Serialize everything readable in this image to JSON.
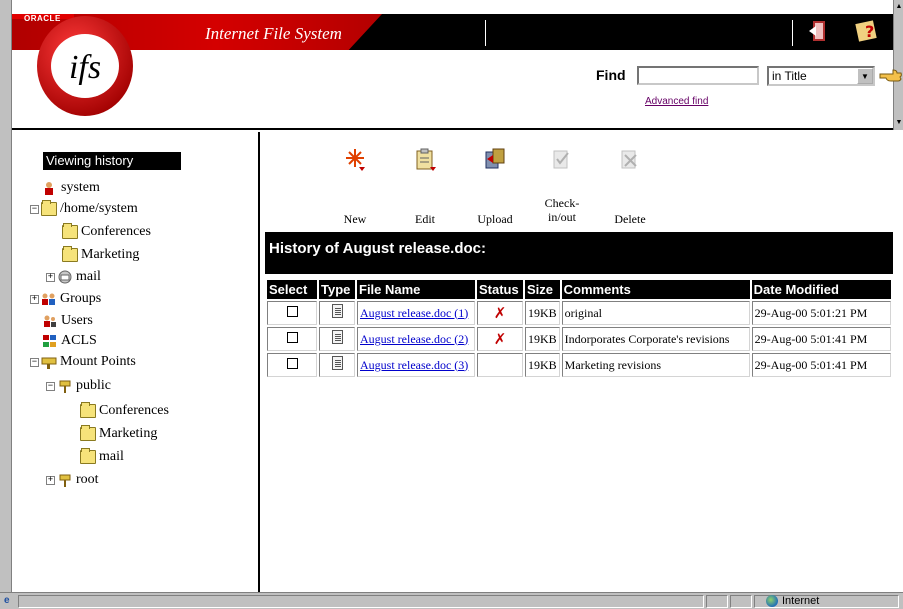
{
  "header": {
    "oracle_logo": "ORACLE",
    "app_logo": "ifs",
    "app_title": "Internet File System",
    "find_label": "Find",
    "find_value": "",
    "find_scope": "in Title",
    "advanced_find": "Advanced find",
    "icons": [
      "logout-icon",
      "help-icon",
      "go-icon"
    ]
  },
  "sidebar": {
    "title": "Viewing history",
    "items": [
      {
        "label": "system",
        "icon": "user-icon"
      },
      {
        "label": "/home/system",
        "icon": "folder-open-icon",
        "toggle": "⊟"
      },
      {
        "label": "Conferences",
        "icon": "folder-icon"
      },
      {
        "label": "Marketing",
        "icon": "folder-icon"
      },
      {
        "label": "mail",
        "icon": "mail-icon",
        "toggle": "⊞"
      },
      {
        "label": "Groups",
        "icon": "groups-icon",
        "toggle": "⊞"
      },
      {
        "label": "Users",
        "icon": "users-icon"
      },
      {
        "label": "ACLS",
        "icon": "acl-icon"
      },
      {
        "label": "Mount Points",
        "icon": "mount-icon",
        "toggle": "⊟"
      },
      {
        "label": "public",
        "icon": "mount-point-icon",
        "toggle": "⊟"
      },
      {
        "label": "Conferences",
        "icon": "folder-icon"
      },
      {
        "label": "Marketing",
        "icon": "folder-icon"
      },
      {
        "label": "mail",
        "icon": "folder-icon"
      },
      {
        "label": "root",
        "icon": "mount-point-icon",
        "toggle": "⊞"
      }
    ]
  },
  "toolbar": {
    "new": "New",
    "edit": "Edit",
    "upload": "Upload",
    "checkinout_1": "Check-",
    "checkinout_2": "in/out",
    "delete": "Delete"
  },
  "history": {
    "title": "History of August release.doc:",
    "columns": [
      "Select",
      "Type",
      "File Name",
      "Status",
      "Size",
      "Comments",
      "Date Modified"
    ],
    "rows": [
      {
        "file": "August release.doc (1)",
        "status": "✗",
        "size": "19KB",
        "comment": "original",
        "date": "29-Aug-00 5:01:21 PM"
      },
      {
        "file": "August release.doc (2)",
        "status": "✗",
        "size": "19KB",
        "comment": "Indorporates Corporate's revisions",
        "date": "29-Aug-00 5:01:41 PM"
      },
      {
        "file": "August release.doc (3)",
        "status": "",
        "size": "19KB",
        "comment": "Marketing revisions",
        "date": "29-Aug-00 5:01:41 PM"
      }
    ]
  },
  "statusbar": {
    "zone": "Internet"
  },
  "colors": {
    "banner_red": "#d40000",
    "black": "#000000",
    "link": "#0000cc",
    "visited": "#660066"
  }
}
